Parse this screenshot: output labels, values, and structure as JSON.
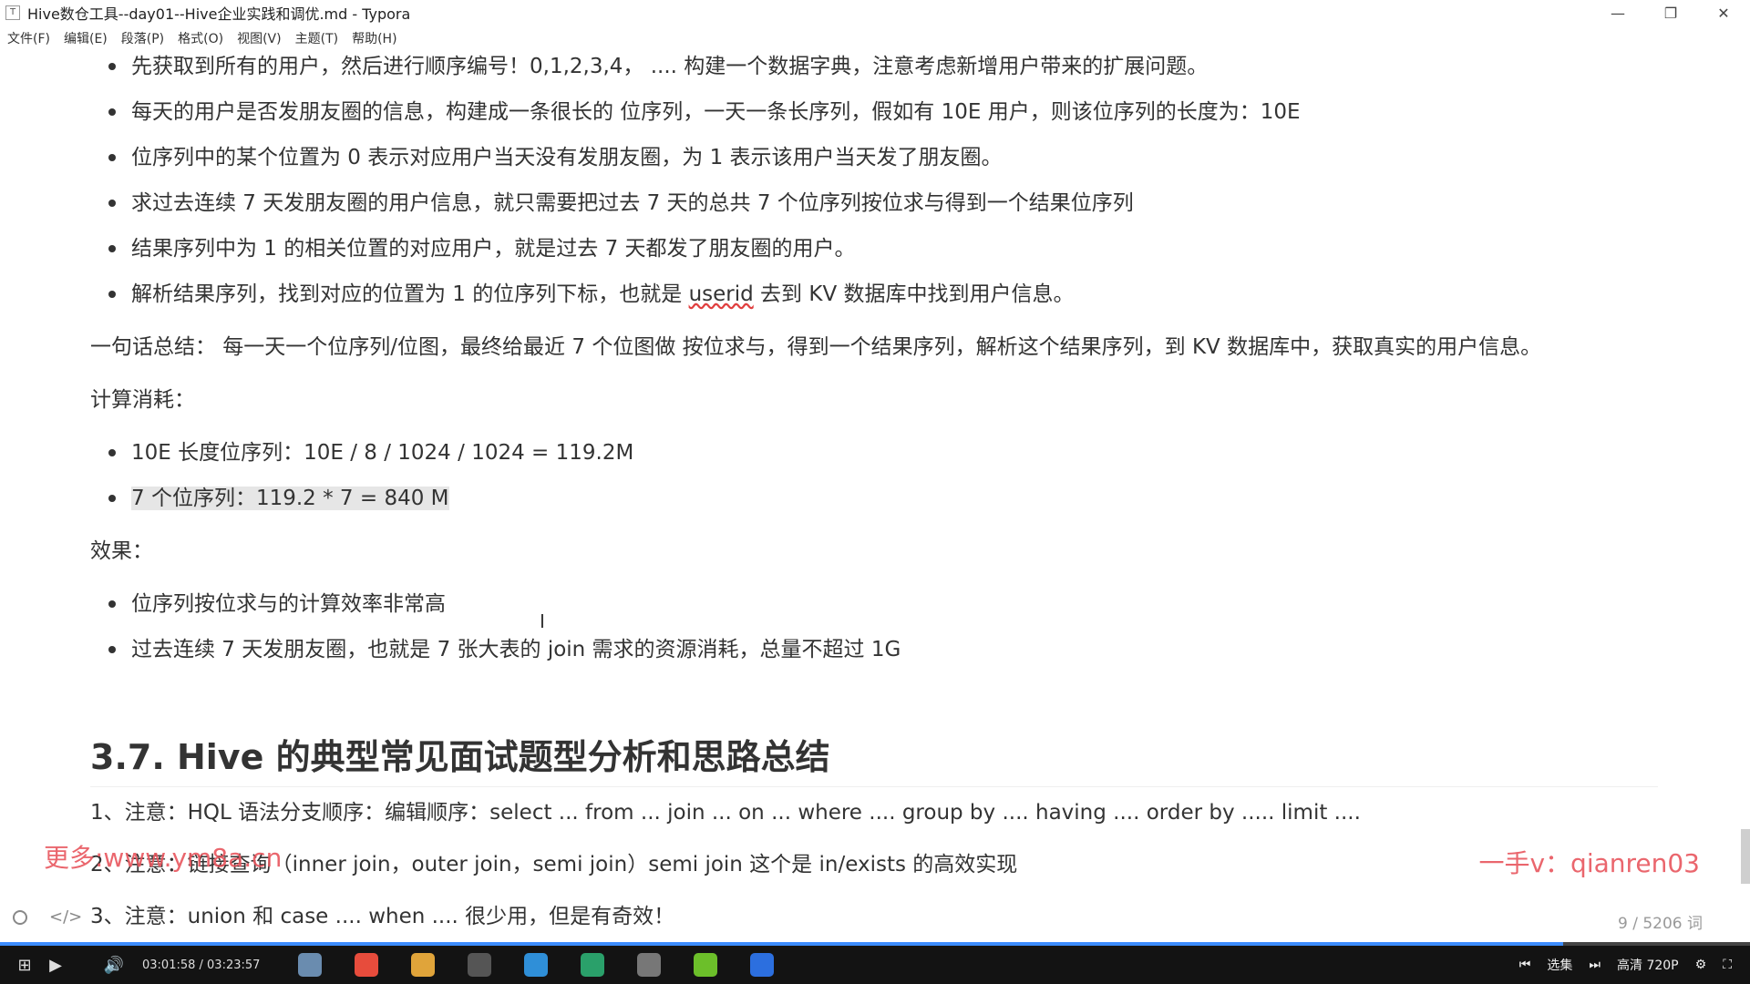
{
  "window": {
    "title": "Hive数仓工具--day01--Hive企业实践和调优.md - Typora",
    "app_icon": "T",
    "minimize_icon": "—",
    "restore_icon": "❐",
    "close_icon": "✕"
  },
  "menu": [
    "文件(F)",
    "编辑(E)",
    "段落(P)",
    "格式(O)",
    "视图(V)",
    "主题(T)",
    "帮助(H)"
  ],
  "content": {
    "bullets_top": [
      "先获取到所有的用户，然后进行顺序编号！0,1,2,3,4， ....  构建一个数据字典，注意考虑新增用户带来的扩展问题。",
      "每天的用户是否发朋友圈的信息，构建成一条很长的 位序列，一天一条长序列，假如有 10E 用户，则该位序列的长度为：10E",
      "位序列中的某个位置为 0 表示对应用户当天没有发朋友圈，为 1 表示该用户当天发了朋友圈。",
      "求过去连续 7 天发朋友圈的用户信息，就只需要把过去 7 天的总共 7 个位序列按位求与得到一个结果位序列",
      "结果序列中为 1 的相关位置的对应用户，就是过去 7 天都发了朋友圈的用户。"
    ],
    "bullet_userid": {
      "before": "解析结果序列，找到对应的位置为 1 的位序列下标，也就是 ",
      "link": "userid",
      "after": " 去到 KV 数据库中找到用户信息。"
    },
    "summary": "一句话总结： 每一天一个位序列/位图，最终给最近 7 个位图做 按位求与，得到一个结果序列，解析这个结果序列，到 KV 数据库中，获取真实的用户信息。",
    "cost_label": "计算消耗：",
    "cost_bullets": [
      "10E 长度位序列：10E / 8 / 1024 / 1024 = 119.2M",
      "7 个位序列：119.2 * 7 = 840 M"
    ],
    "effect_label": "效果：",
    "effect_bullets": [
      "位序列按位求与的计算效率非常高",
      "过去连续 7 天发朋友圈，也就是 7 张大表的 join 需求的资源消耗，总量不超过 1G"
    ],
    "heading": "3.7. Hive 的典型常见面试题型分析和思路总结",
    "numbered": [
      "1、注意：HQL 语法分支顺序：编辑顺序：select ... from ... join ... on ... where .... group by .... having .... order by ..... limit ....",
      "2、注意：链接查询（inner join，outer join，semi join）semi join 这个是 in/exists 的高效实现",
      "3、注意：union 和 case ....  when ....   很少用，但是有奇效！"
    ]
  },
  "watermarks": {
    "left": "更多:www.ym8a.cn",
    "right": "一手v：qianren03"
  },
  "status": {
    "circle_icon": "circle-icon",
    "code_icon": "</>",
    "word_count": "9 / 5206 词"
  },
  "player": {
    "time": "03:01:58 / 03:23:57",
    "progress": 0.893,
    "play_icon": "▶",
    "volume_icon": "🔊",
    "episodes": "选集",
    "quality": "高清 720P",
    "prev_icon": "⏮",
    "next_icon": "⏭",
    "gear_icon": "⚙",
    "fullscreen_icon": "⛶",
    "windows_icon": "⊞",
    "app_colors": [
      "#6a8caf",
      "#e74c3c",
      "#e0a43a",
      "#555555",
      "#2f8fd8",
      "#2aa06a",
      "#777777",
      "#6cbf2a",
      "#2c6fdf"
    ]
  }
}
